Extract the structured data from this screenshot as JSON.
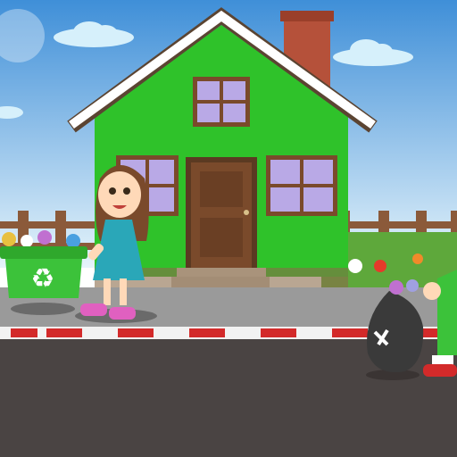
{
  "scene": {
    "colors": {
      "sky_top": "#3f8fd8",
      "sky_bottom": "#e6f4fb",
      "house_wall": "#2fc22a",
      "roof": "#ffffff",
      "roof_edge": "#5b4432",
      "chimney": "#b5513a",
      "door": "#7a4a2b",
      "window_frame": "#7a4a2b",
      "window_glass": "#b9a9e6",
      "fence": "#8b5a3a",
      "grass": "#5ea83b",
      "sidewalk": "#9a9a9a",
      "curb_red": "#d32a2a",
      "curb_white": "#f2f2f2",
      "road": "#4a4443",
      "bin": "#3cc23a",
      "girl_dress": "#2aa7b8",
      "trash_bag": "#3a3a3a"
    },
    "icons": [
      "recycle-icon"
    ]
  }
}
